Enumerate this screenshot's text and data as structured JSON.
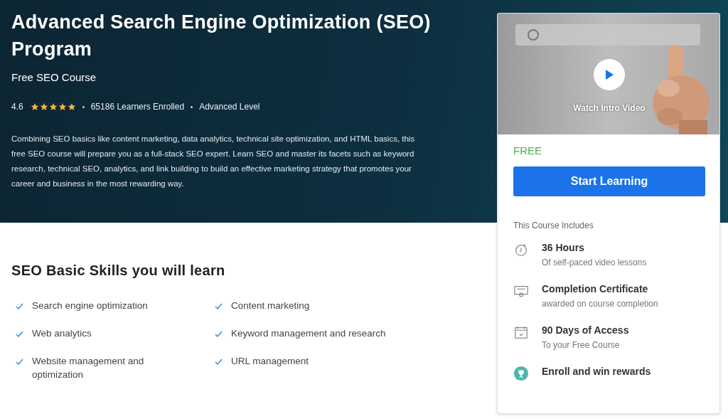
{
  "hero": {
    "title": "Advanced Search Engine Optimization (SEO) Program",
    "subtitle": "Free SEO Course",
    "rating": "4.6",
    "stars": 5,
    "learners": "65186 Learners Enrolled",
    "level_label": "Advanced Level",
    "description": "Combining SEO basics like content marketing, data analytics, technical site optimization, and HTML basics, this free SEO course will prepare you as a full-stack SEO expert. Learn SEO and master its facets such as keyword research, technical SEO, analytics, and link building to build an effective marketing strategy that promotes your career and business in the most rewarding way."
  },
  "skills": {
    "heading": "SEO Basic Skills you will learn",
    "items": [
      "Search engine optimization",
      "Content marketing",
      "Web analytics",
      "Keyword management and research",
      "Website management and optimization",
      "URL management"
    ]
  },
  "card": {
    "video": {
      "kind": "picture",
      "label": "Watch Intro Video"
    },
    "price": "FREE",
    "button": "Start Learning",
    "includes_heading": "This Course Includes",
    "includes": [
      {
        "kind": "clock",
        "title": "36 Hours",
        "detail": "Of self-paced video lessons"
      },
      {
        "kind": "certificate",
        "title": "Completion Certificate",
        "detail": "awarded on course completion"
      },
      {
        "kind": "calendar",
        "title": "90 Days of Access",
        "detail": "To your Free Course"
      },
      {
        "kind": "trophy",
        "title": "Enroll and win rewards"
      }
    ]
  }
}
